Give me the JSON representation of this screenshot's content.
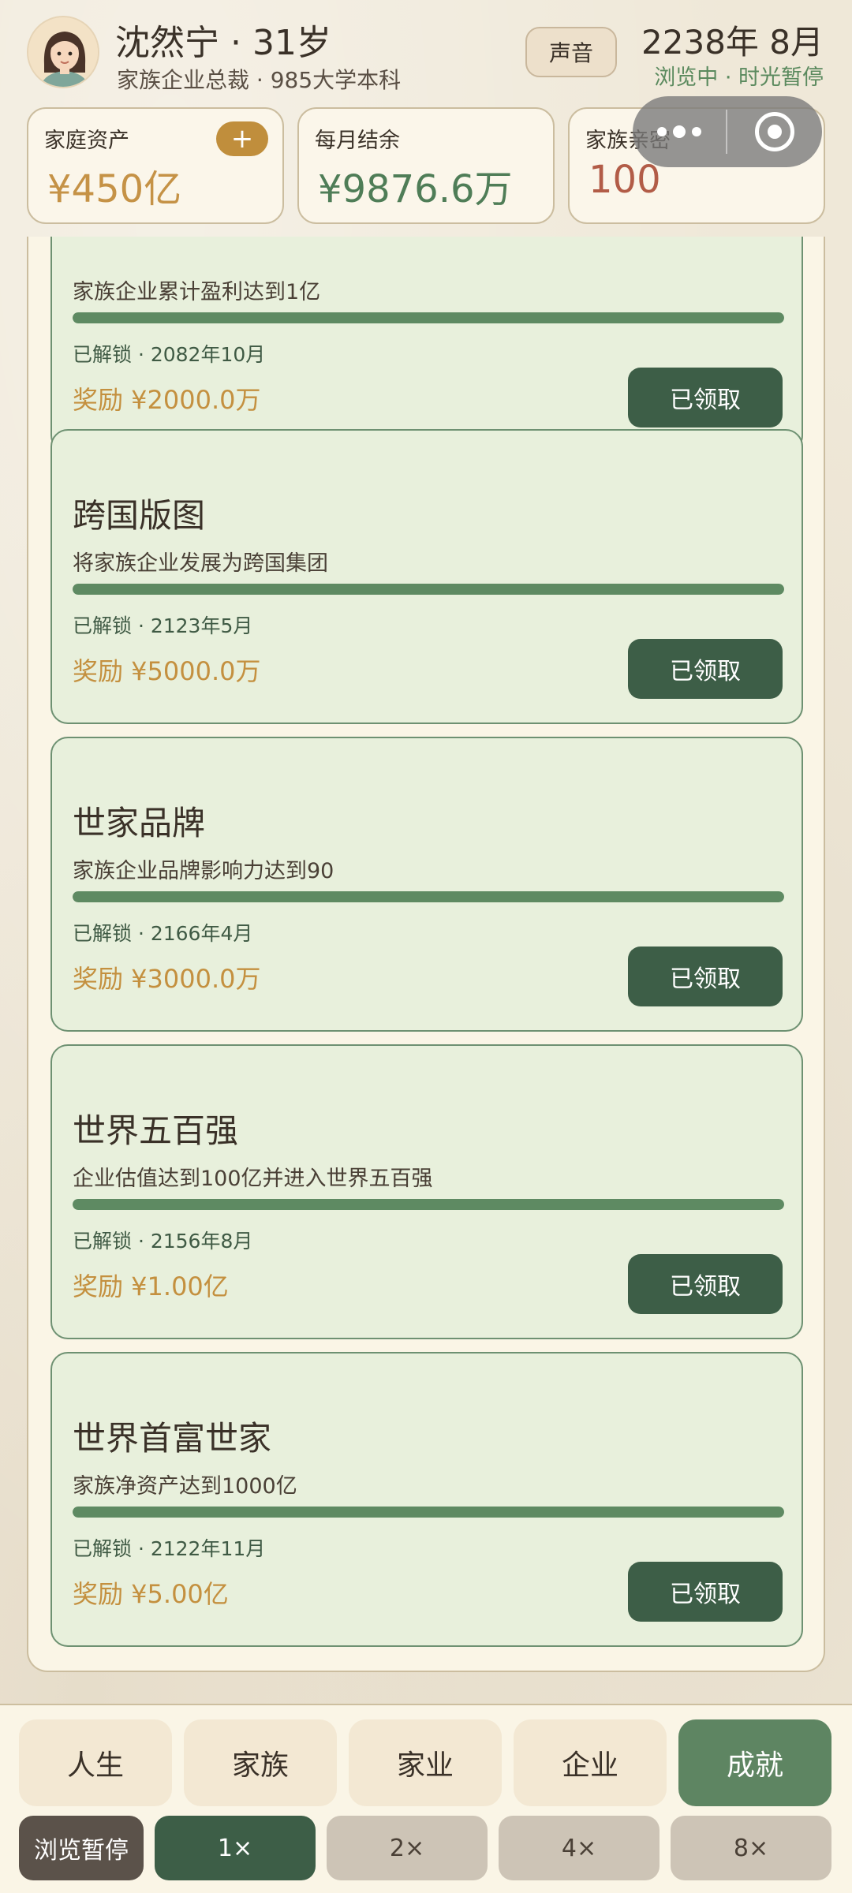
{
  "header": {
    "name": "沈然宁 · 31岁",
    "subtitle": "家族企业总裁 · 985大学本科",
    "sound_label": "声音",
    "date": "2238年 8月",
    "status": "浏览中 · 时光暂停"
  },
  "stats": {
    "assets": {
      "label": "家庭资产",
      "value": "¥450亿",
      "add_label": "+"
    },
    "monthly": {
      "label": "每月结余",
      "value": "¥9876.6万"
    },
    "intimacy": {
      "label": "家族亲密",
      "value": "100"
    }
  },
  "achievements": [
    {
      "title": "",
      "desc": "家族企业累计盈利达到1亿",
      "progress": 1.0,
      "unlock": "已解锁 · 2082年10月",
      "reward": "奖励 ¥2000.0万",
      "claim": "已领取"
    },
    {
      "title": "跨国版图",
      "desc": "将家族企业发展为跨国集团",
      "progress": 1.0,
      "unlock": "已解锁 · 2123年5月",
      "reward": "奖励 ¥5000.0万",
      "claim": "已领取"
    },
    {
      "title": "世家品牌",
      "desc": "家族企业品牌影响力达到90",
      "progress": 1.0,
      "unlock": "已解锁 · 2166年4月",
      "reward": "奖励 ¥3000.0万",
      "claim": "已领取"
    },
    {
      "title": "世界五百强",
      "desc": "企业估值达到100亿并进入世界五百强",
      "progress": 1.0,
      "unlock": "已解锁 · 2156年8月",
      "reward": "奖励 ¥1.00亿",
      "claim": "已领取"
    },
    {
      "title": "世界首富世家",
      "desc": "家族净资产达到1000亿",
      "progress": 1.0,
      "unlock": "已解锁 · 2122年11月",
      "reward": "奖励 ¥5.00亿",
      "claim": "已领取"
    }
  ],
  "tabs": [
    {
      "label": "人生",
      "active": false
    },
    {
      "label": "家族",
      "active": false
    },
    {
      "label": "家业",
      "active": false
    },
    {
      "label": "企业",
      "active": false
    },
    {
      "label": "成就",
      "active": true
    }
  ],
  "speed": {
    "pause_label": "浏览暂停",
    "options": [
      "1×",
      "2×",
      "4×",
      "8×"
    ],
    "selected": "1×"
  },
  "colors": {
    "accent_green": "#3d5e47",
    "progress_green": "#5e8a62",
    "reward_gold": "#c4903f",
    "card_bg": "#e8f0dc"
  },
  "icons": {
    "avatar": "avatar-portrait",
    "capsule_more": "more-dots-icon",
    "capsule_close": "target-close-icon"
  }
}
